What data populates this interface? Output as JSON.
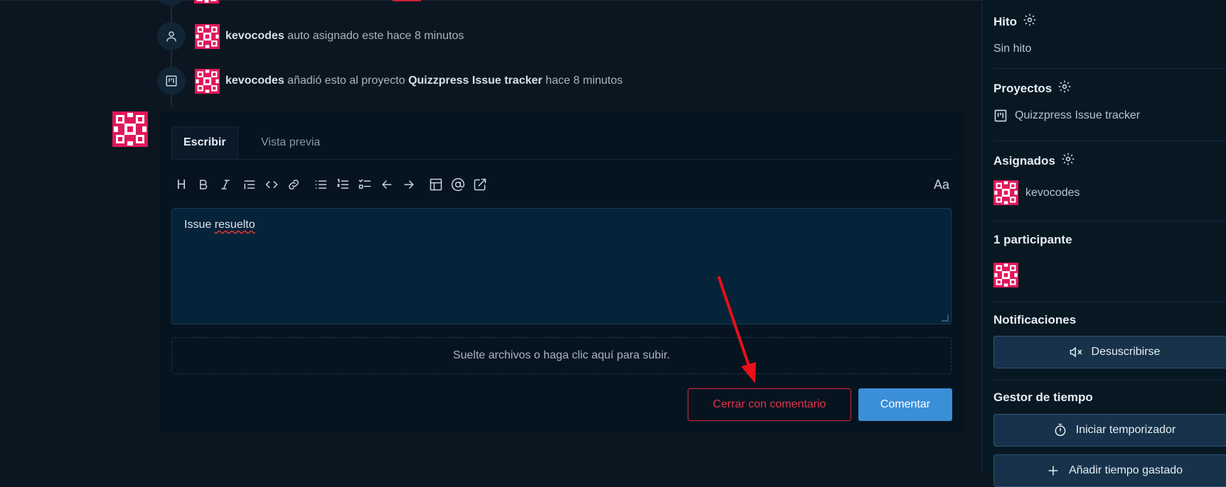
{
  "timeline": {
    "events": [
      {
        "user": "kevocodes",
        "action": "auto asignado este hace 8 minutos"
      },
      {
        "user": "kevocodes",
        "action_before": "añadió esto al proyecto",
        "project": "Quizzpress Issue tracker",
        "time": "hace 8 minutos"
      }
    ]
  },
  "editor": {
    "tabs": {
      "write": "Escribir",
      "preview": "Vista previa"
    },
    "toolbar": {
      "heading": "H",
      "font_size": "Aa"
    },
    "text_before": "Issue ",
    "text_misspelled": "resuelto",
    "dropzone": "Suelte archivos o haga clic aquí para subir.",
    "close_with_comment": "Cerrar con comentario",
    "comment": "Comentar"
  },
  "sidebar": {
    "milestone": {
      "title": "Hito",
      "value": "Sin hito"
    },
    "projects": {
      "title": "Proyectos",
      "value": "Quizzpress Issue tracker"
    },
    "assignees": {
      "title": "Asignados",
      "value": "kevocodes"
    },
    "participants": {
      "title": "1 participante"
    },
    "notifications": {
      "title": "Notificaciones",
      "button": "Desuscribirse"
    },
    "time_tracker": {
      "title": "Gestor de tiempo",
      "start_button": "Iniciar temporizador",
      "add_button": "Añadir tiempo gastado"
    }
  },
  "colors": {
    "accent": "#3b8ed8",
    "danger": "#e0334b",
    "avatar": "#e0185b",
    "annotation_arrow": "#e8101a"
  }
}
